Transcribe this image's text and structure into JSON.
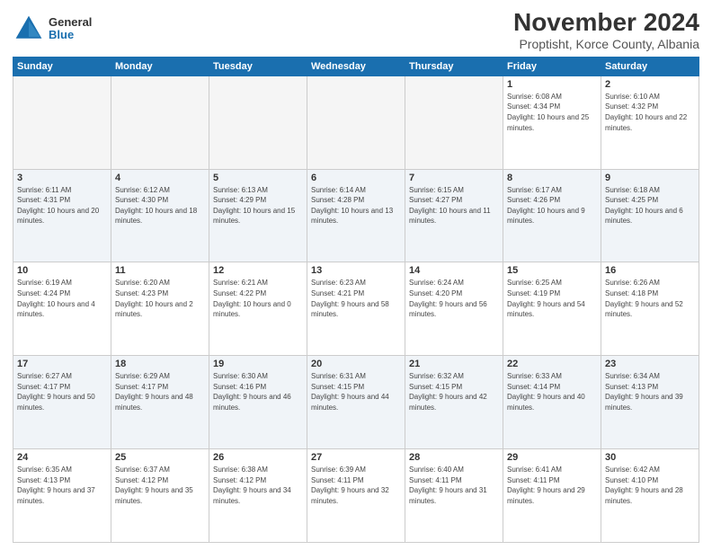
{
  "logo": {
    "general": "General",
    "blue": "Blue"
  },
  "header": {
    "title": "November 2024",
    "subtitle": "Proptisht, Korce County, Albania"
  },
  "weekdays": [
    "Sunday",
    "Monday",
    "Tuesday",
    "Wednesday",
    "Thursday",
    "Friday",
    "Saturday"
  ],
  "weeks": [
    [
      {
        "day": "",
        "empty": true
      },
      {
        "day": "",
        "empty": true
      },
      {
        "day": "",
        "empty": true
      },
      {
        "day": "",
        "empty": true
      },
      {
        "day": "",
        "empty": true
      },
      {
        "day": "1",
        "sunrise": "Sunrise: 6:08 AM",
        "sunset": "Sunset: 4:34 PM",
        "daylight": "Daylight: 10 hours and 25 minutes."
      },
      {
        "day": "2",
        "sunrise": "Sunrise: 6:10 AM",
        "sunset": "Sunset: 4:32 PM",
        "daylight": "Daylight: 10 hours and 22 minutes."
      }
    ],
    [
      {
        "day": "3",
        "sunrise": "Sunrise: 6:11 AM",
        "sunset": "Sunset: 4:31 PM",
        "daylight": "Daylight: 10 hours and 20 minutes."
      },
      {
        "day": "4",
        "sunrise": "Sunrise: 6:12 AM",
        "sunset": "Sunset: 4:30 PM",
        "daylight": "Daylight: 10 hours and 18 minutes."
      },
      {
        "day": "5",
        "sunrise": "Sunrise: 6:13 AM",
        "sunset": "Sunset: 4:29 PM",
        "daylight": "Daylight: 10 hours and 15 minutes."
      },
      {
        "day": "6",
        "sunrise": "Sunrise: 6:14 AM",
        "sunset": "Sunset: 4:28 PM",
        "daylight": "Daylight: 10 hours and 13 minutes."
      },
      {
        "day": "7",
        "sunrise": "Sunrise: 6:15 AM",
        "sunset": "Sunset: 4:27 PM",
        "daylight": "Daylight: 10 hours and 11 minutes."
      },
      {
        "day": "8",
        "sunrise": "Sunrise: 6:17 AM",
        "sunset": "Sunset: 4:26 PM",
        "daylight": "Daylight: 10 hours and 9 minutes."
      },
      {
        "day": "9",
        "sunrise": "Sunrise: 6:18 AM",
        "sunset": "Sunset: 4:25 PM",
        "daylight": "Daylight: 10 hours and 6 minutes."
      }
    ],
    [
      {
        "day": "10",
        "sunrise": "Sunrise: 6:19 AM",
        "sunset": "Sunset: 4:24 PM",
        "daylight": "Daylight: 10 hours and 4 minutes."
      },
      {
        "day": "11",
        "sunrise": "Sunrise: 6:20 AM",
        "sunset": "Sunset: 4:23 PM",
        "daylight": "Daylight: 10 hours and 2 minutes."
      },
      {
        "day": "12",
        "sunrise": "Sunrise: 6:21 AM",
        "sunset": "Sunset: 4:22 PM",
        "daylight": "Daylight: 10 hours and 0 minutes."
      },
      {
        "day": "13",
        "sunrise": "Sunrise: 6:23 AM",
        "sunset": "Sunset: 4:21 PM",
        "daylight": "Daylight: 9 hours and 58 minutes."
      },
      {
        "day": "14",
        "sunrise": "Sunrise: 6:24 AM",
        "sunset": "Sunset: 4:20 PM",
        "daylight": "Daylight: 9 hours and 56 minutes."
      },
      {
        "day": "15",
        "sunrise": "Sunrise: 6:25 AM",
        "sunset": "Sunset: 4:19 PM",
        "daylight": "Daylight: 9 hours and 54 minutes."
      },
      {
        "day": "16",
        "sunrise": "Sunrise: 6:26 AM",
        "sunset": "Sunset: 4:18 PM",
        "daylight": "Daylight: 9 hours and 52 minutes."
      }
    ],
    [
      {
        "day": "17",
        "sunrise": "Sunrise: 6:27 AM",
        "sunset": "Sunset: 4:17 PM",
        "daylight": "Daylight: 9 hours and 50 minutes."
      },
      {
        "day": "18",
        "sunrise": "Sunrise: 6:29 AM",
        "sunset": "Sunset: 4:17 PM",
        "daylight": "Daylight: 9 hours and 48 minutes."
      },
      {
        "day": "19",
        "sunrise": "Sunrise: 6:30 AM",
        "sunset": "Sunset: 4:16 PM",
        "daylight": "Daylight: 9 hours and 46 minutes."
      },
      {
        "day": "20",
        "sunrise": "Sunrise: 6:31 AM",
        "sunset": "Sunset: 4:15 PM",
        "daylight": "Daylight: 9 hours and 44 minutes."
      },
      {
        "day": "21",
        "sunrise": "Sunrise: 6:32 AM",
        "sunset": "Sunset: 4:15 PM",
        "daylight": "Daylight: 9 hours and 42 minutes."
      },
      {
        "day": "22",
        "sunrise": "Sunrise: 6:33 AM",
        "sunset": "Sunset: 4:14 PM",
        "daylight": "Daylight: 9 hours and 40 minutes."
      },
      {
        "day": "23",
        "sunrise": "Sunrise: 6:34 AM",
        "sunset": "Sunset: 4:13 PM",
        "daylight": "Daylight: 9 hours and 39 minutes."
      }
    ],
    [
      {
        "day": "24",
        "sunrise": "Sunrise: 6:35 AM",
        "sunset": "Sunset: 4:13 PM",
        "daylight": "Daylight: 9 hours and 37 minutes."
      },
      {
        "day": "25",
        "sunrise": "Sunrise: 6:37 AM",
        "sunset": "Sunset: 4:12 PM",
        "daylight": "Daylight: 9 hours and 35 minutes."
      },
      {
        "day": "26",
        "sunrise": "Sunrise: 6:38 AM",
        "sunset": "Sunset: 4:12 PM",
        "daylight": "Daylight: 9 hours and 34 minutes."
      },
      {
        "day": "27",
        "sunrise": "Sunrise: 6:39 AM",
        "sunset": "Sunset: 4:11 PM",
        "daylight": "Daylight: 9 hours and 32 minutes."
      },
      {
        "day": "28",
        "sunrise": "Sunrise: 6:40 AM",
        "sunset": "Sunset: 4:11 PM",
        "daylight": "Daylight: 9 hours and 31 minutes."
      },
      {
        "day": "29",
        "sunrise": "Sunrise: 6:41 AM",
        "sunset": "Sunset: 4:11 PM",
        "daylight": "Daylight: 9 hours and 29 minutes."
      },
      {
        "day": "30",
        "sunrise": "Sunrise: 6:42 AM",
        "sunset": "Sunset: 4:10 PM",
        "daylight": "Daylight: 9 hours and 28 minutes."
      }
    ]
  ]
}
